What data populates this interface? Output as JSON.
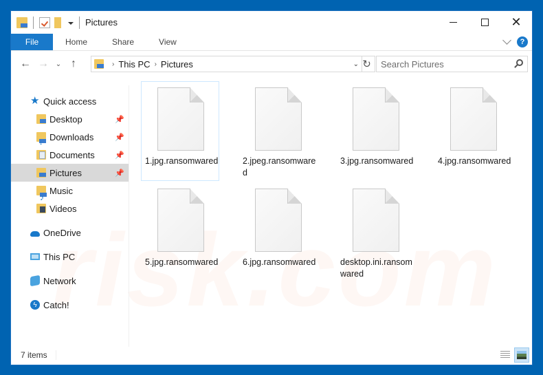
{
  "window": {
    "title": "Pictures",
    "controls": {
      "minimize": "minimize",
      "maximize": "maximize",
      "close": "close"
    }
  },
  "quick_access_toolbar": {
    "icons": [
      "folder-pictures-icon",
      "properties-icon",
      "new-folder-icon",
      "customize-dropdown-icon"
    ]
  },
  "ribbon": {
    "tabs": [
      {
        "label": "File",
        "active": true
      },
      {
        "label": "Home"
      },
      {
        "label": "Share"
      },
      {
        "label": "View"
      }
    ],
    "help": "?"
  },
  "address_bar": {
    "breadcrumbs": [
      "This PC",
      "Pictures"
    ],
    "search_placeholder": "Search Pictures"
  },
  "nav_pane": {
    "quick_access": "Quick access",
    "pinned": [
      {
        "label": "Desktop",
        "pinned": true
      },
      {
        "label": "Downloads",
        "pinned": true
      },
      {
        "label": "Documents",
        "pinned": true
      },
      {
        "label": "Pictures",
        "pinned": true,
        "selected": true
      },
      {
        "label": "Music"
      },
      {
        "label": "Videos"
      }
    ],
    "locations": [
      "OneDrive",
      "This PC",
      "Network",
      "Catch!"
    ]
  },
  "files": [
    {
      "name": "1.jpg.ransomwared"
    },
    {
      "name": "2.jpeg.ransomwared"
    },
    {
      "name": "3.jpg.ransomwared"
    },
    {
      "name": "4.jpg.ransomwared"
    },
    {
      "name": "5.jpg.ransomwared"
    },
    {
      "name": "6.jpg.ransomwared"
    },
    {
      "name": "desktop.ini.ransomwared"
    }
  ],
  "status": {
    "item_count": "7 items"
  },
  "colors": {
    "accent": "#1979ca",
    "desktop_bg": "#0063b1",
    "selection": "#d9d9d9"
  }
}
